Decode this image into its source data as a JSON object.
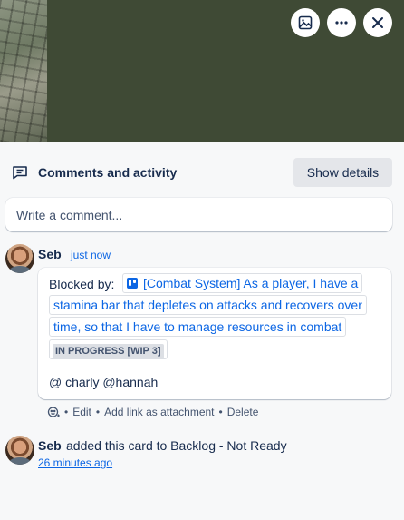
{
  "header": {
    "title": "Comments and activity",
    "show_details_label": "Show details"
  },
  "comment_input": {
    "placeholder": "Write a comment..."
  },
  "comment": {
    "author": "Seb",
    "time": "just now",
    "blocked_label": "Blocked by:",
    "linked_card_lines": [
      "[Combat System] As a player, I have a",
      "stamina bar that depletes on attacks and recovers over",
      "time, so that I have to manage resources in combat"
    ],
    "status_badge": "IN PROGRESS [WIP 3]",
    "mentions": "@ charly @hannah",
    "actions": {
      "edit": "Edit",
      "add_link": "Add link as attachment",
      "delete": "Delete",
      "separator": "•"
    }
  },
  "activity": {
    "author": "Seb",
    "text": "added this card to Backlog - Not Ready",
    "time": "26 minutes ago"
  },
  "colors": {
    "cover_background": "#3f4a35",
    "link": "#0c66e4",
    "text": "#172b4d",
    "subtle": "#44546f"
  },
  "icons": {
    "cover_image": "image-icon",
    "more": "more-icon",
    "close": "close-icon",
    "comments": "comments-icon",
    "card_link": "trello-icon",
    "reaction": "add-reaction-icon"
  }
}
